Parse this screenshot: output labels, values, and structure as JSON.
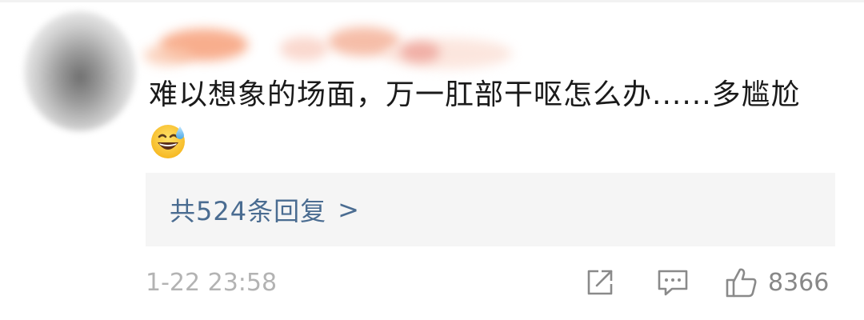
{
  "comment": {
    "text": "难以想象的场面，万一肛部干呕怎么办......多尴尬",
    "emoji": "sweat-smile-emoji"
  },
  "replies": {
    "label": "共524条回复",
    "arrow": ">"
  },
  "meta": {
    "timestamp": "1-22 23:58",
    "like_count": "8366"
  },
  "colors": {
    "reply_link": "#4a6c91",
    "meta_text": "#b3b3b3",
    "icon": "#8a8a8a",
    "reply_bg": "#f5f5f5"
  },
  "icons": {
    "share": "share-icon",
    "comment": "comment-icon",
    "like": "thumbs-up-icon"
  }
}
